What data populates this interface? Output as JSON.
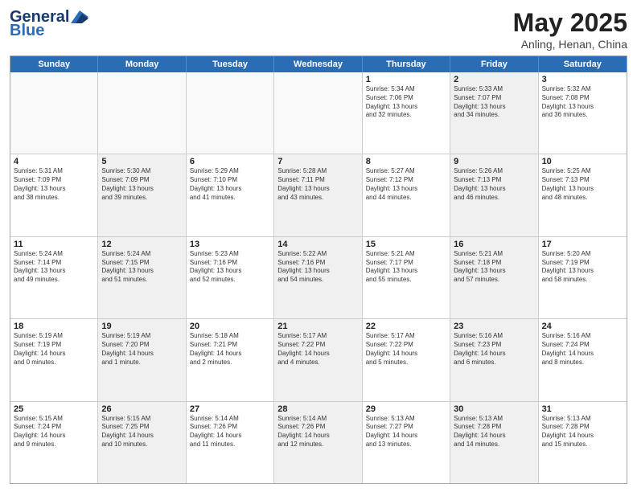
{
  "header": {
    "logo_line1a": "General",
    "logo_line1b": "Blue",
    "month_year": "May 2025",
    "location": "Anling, Henan, China"
  },
  "days_of_week": [
    "Sunday",
    "Monday",
    "Tuesday",
    "Wednesday",
    "Thursday",
    "Friday",
    "Saturday"
  ],
  "weeks": [
    [
      {
        "day": "",
        "info": "",
        "shaded": false,
        "empty": true
      },
      {
        "day": "",
        "info": "",
        "shaded": false,
        "empty": true
      },
      {
        "day": "",
        "info": "",
        "shaded": false,
        "empty": true
      },
      {
        "day": "",
        "info": "",
        "shaded": false,
        "empty": true
      },
      {
        "day": "1",
        "info": "Sunrise: 5:34 AM\nSunset: 7:06 PM\nDaylight: 13 hours\nand 32 minutes.",
        "shaded": false,
        "empty": false
      },
      {
        "day": "2",
        "info": "Sunrise: 5:33 AM\nSunset: 7:07 PM\nDaylight: 13 hours\nand 34 minutes.",
        "shaded": true,
        "empty": false
      },
      {
        "day": "3",
        "info": "Sunrise: 5:32 AM\nSunset: 7:08 PM\nDaylight: 13 hours\nand 36 minutes.",
        "shaded": false,
        "empty": false
      }
    ],
    [
      {
        "day": "4",
        "info": "Sunrise: 5:31 AM\nSunset: 7:09 PM\nDaylight: 13 hours\nand 38 minutes.",
        "shaded": false,
        "empty": false
      },
      {
        "day": "5",
        "info": "Sunrise: 5:30 AM\nSunset: 7:09 PM\nDaylight: 13 hours\nand 39 minutes.",
        "shaded": true,
        "empty": false
      },
      {
        "day": "6",
        "info": "Sunrise: 5:29 AM\nSunset: 7:10 PM\nDaylight: 13 hours\nand 41 minutes.",
        "shaded": false,
        "empty": false
      },
      {
        "day": "7",
        "info": "Sunrise: 5:28 AM\nSunset: 7:11 PM\nDaylight: 13 hours\nand 43 minutes.",
        "shaded": true,
        "empty": false
      },
      {
        "day": "8",
        "info": "Sunrise: 5:27 AM\nSunset: 7:12 PM\nDaylight: 13 hours\nand 44 minutes.",
        "shaded": false,
        "empty": false
      },
      {
        "day": "9",
        "info": "Sunrise: 5:26 AM\nSunset: 7:13 PM\nDaylight: 13 hours\nand 46 minutes.",
        "shaded": true,
        "empty": false
      },
      {
        "day": "10",
        "info": "Sunrise: 5:25 AM\nSunset: 7:13 PM\nDaylight: 13 hours\nand 48 minutes.",
        "shaded": false,
        "empty": false
      }
    ],
    [
      {
        "day": "11",
        "info": "Sunrise: 5:24 AM\nSunset: 7:14 PM\nDaylight: 13 hours\nand 49 minutes.",
        "shaded": false,
        "empty": false
      },
      {
        "day": "12",
        "info": "Sunrise: 5:24 AM\nSunset: 7:15 PM\nDaylight: 13 hours\nand 51 minutes.",
        "shaded": true,
        "empty": false
      },
      {
        "day": "13",
        "info": "Sunrise: 5:23 AM\nSunset: 7:16 PM\nDaylight: 13 hours\nand 52 minutes.",
        "shaded": false,
        "empty": false
      },
      {
        "day": "14",
        "info": "Sunrise: 5:22 AM\nSunset: 7:16 PM\nDaylight: 13 hours\nand 54 minutes.",
        "shaded": true,
        "empty": false
      },
      {
        "day": "15",
        "info": "Sunrise: 5:21 AM\nSunset: 7:17 PM\nDaylight: 13 hours\nand 55 minutes.",
        "shaded": false,
        "empty": false
      },
      {
        "day": "16",
        "info": "Sunrise: 5:21 AM\nSunset: 7:18 PM\nDaylight: 13 hours\nand 57 minutes.",
        "shaded": true,
        "empty": false
      },
      {
        "day": "17",
        "info": "Sunrise: 5:20 AM\nSunset: 7:19 PM\nDaylight: 13 hours\nand 58 minutes.",
        "shaded": false,
        "empty": false
      }
    ],
    [
      {
        "day": "18",
        "info": "Sunrise: 5:19 AM\nSunset: 7:19 PM\nDaylight: 14 hours\nand 0 minutes.",
        "shaded": false,
        "empty": false
      },
      {
        "day": "19",
        "info": "Sunrise: 5:19 AM\nSunset: 7:20 PM\nDaylight: 14 hours\nand 1 minute.",
        "shaded": true,
        "empty": false
      },
      {
        "day": "20",
        "info": "Sunrise: 5:18 AM\nSunset: 7:21 PM\nDaylight: 14 hours\nand 2 minutes.",
        "shaded": false,
        "empty": false
      },
      {
        "day": "21",
        "info": "Sunrise: 5:17 AM\nSunset: 7:22 PM\nDaylight: 14 hours\nand 4 minutes.",
        "shaded": true,
        "empty": false
      },
      {
        "day": "22",
        "info": "Sunrise: 5:17 AM\nSunset: 7:22 PM\nDaylight: 14 hours\nand 5 minutes.",
        "shaded": false,
        "empty": false
      },
      {
        "day": "23",
        "info": "Sunrise: 5:16 AM\nSunset: 7:23 PM\nDaylight: 14 hours\nand 6 minutes.",
        "shaded": true,
        "empty": false
      },
      {
        "day": "24",
        "info": "Sunrise: 5:16 AM\nSunset: 7:24 PM\nDaylight: 14 hours\nand 8 minutes.",
        "shaded": false,
        "empty": false
      }
    ],
    [
      {
        "day": "25",
        "info": "Sunrise: 5:15 AM\nSunset: 7:24 PM\nDaylight: 14 hours\nand 9 minutes.",
        "shaded": false,
        "empty": false
      },
      {
        "day": "26",
        "info": "Sunrise: 5:15 AM\nSunset: 7:25 PM\nDaylight: 14 hours\nand 10 minutes.",
        "shaded": true,
        "empty": false
      },
      {
        "day": "27",
        "info": "Sunrise: 5:14 AM\nSunset: 7:26 PM\nDaylight: 14 hours\nand 11 minutes.",
        "shaded": false,
        "empty": false
      },
      {
        "day": "28",
        "info": "Sunrise: 5:14 AM\nSunset: 7:26 PM\nDaylight: 14 hours\nand 12 minutes.",
        "shaded": true,
        "empty": false
      },
      {
        "day": "29",
        "info": "Sunrise: 5:13 AM\nSunset: 7:27 PM\nDaylight: 14 hours\nand 13 minutes.",
        "shaded": false,
        "empty": false
      },
      {
        "day": "30",
        "info": "Sunrise: 5:13 AM\nSunset: 7:28 PM\nDaylight: 14 hours\nand 14 minutes.",
        "shaded": true,
        "empty": false
      },
      {
        "day": "31",
        "info": "Sunrise: 5:13 AM\nSunset: 7:28 PM\nDaylight: 14 hours\nand 15 minutes.",
        "shaded": false,
        "empty": false
      }
    ]
  ]
}
